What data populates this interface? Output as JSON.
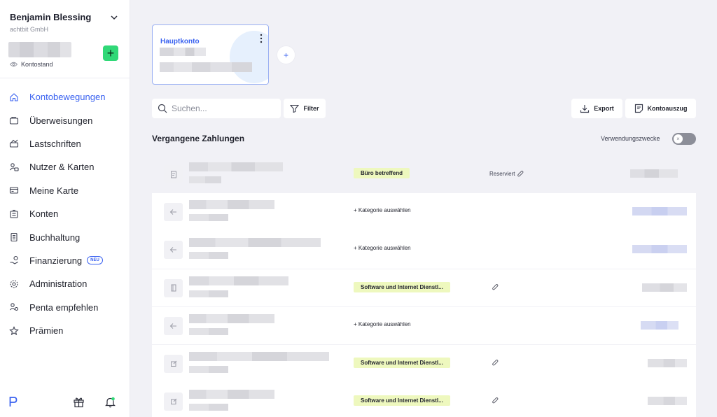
{
  "sidebar": {
    "user_name": "Benjamin Blessing",
    "company": "achtbit GmbH",
    "balance_label": "Kontostand",
    "add_button": "+",
    "items": [
      {
        "label": "Kontobewegungen",
        "icon": "home-icon",
        "active": true
      },
      {
        "label": "Überweisungen",
        "icon": "transfer-icon"
      },
      {
        "label": "Lastschriften",
        "icon": "direct-debit-icon"
      },
      {
        "label": "Nutzer & Karten",
        "icon": "users-cards-icon"
      },
      {
        "label": "Meine Karte",
        "icon": "card-icon"
      },
      {
        "label": "Konten",
        "icon": "accounts-icon"
      },
      {
        "label": "Buchhaltung",
        "icon": "accounting-icon"
      },
      {
        "label": "Finanzierung",
        "icon": "financing-icon",
        "badge": "NEU"
      },
      {
        "label": "Administration",
        "icon": "gear-icon"
      },
      {
        "label": "Penta empfehlen",
        "icon": "recommend-icon"
      },
      {
        "label": "Prämien",
        "icon": "star-icon"
      }
    ]
  },
  "account_card": {
    "title": "Hauptkonto",
    "add_label": "+"
  },
  "toolbar": {
    "search_placeholder": "Suchen...",
    "filter_label": "Filter",
    "export_label": "Export",
    "statement_label": "Kontoauszug"
  },
  "section": {
    "title": "Vergangene Zahlungen",
    "purpose_toggle_label": "Verwendungszwecke",
    "toggle_symbol": "×"
  },
  "payments": [
    {
      "tag": "Büro betreffend",
      "note": "Reserviert",
      "icon": "document-icon"
    },
    {
      "category": "+ Kategorie auswählen",
      "icon": "arrow-left-icon"
    },
    {
      "category": "+ Kategorie auswählen",
      "icon": "arrow-left-icon"
    },
    {
      "tag": "Software und Internet Dienstl...",
      "icon": "book-icon"
    },
    {
      "category": "+ Kategorie auswählen",
      "icon": "arrow-left-icon"
    },
    {
      "tag": "Software und Internet Dienstl...",
      "icon": "edit-icon"
    },
    {
      "tag": "Software und Internet Dienstl...",
      "icon": "edit-icon"
    }
  ],
  "colors": {
    "accent": "#3a62f0",
    "add_green": "#30d877",
    "tag_bg": "#eef8be"
  }
}
